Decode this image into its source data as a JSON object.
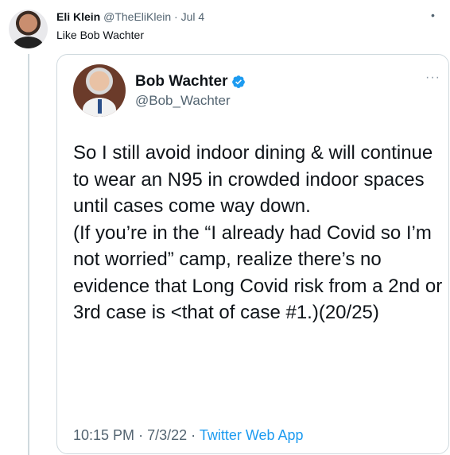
{
  "reply": {
    "author_name": "Eli Klein",
    "author_handle": "@TheEliKlein",
    "separator": "·",
    "date": "Jul 4",
    "more_icon": "more-horizontal-icon",
    "text": "Like Bob Wachter"
  },
  "quoted": {
    "author_name": "Bob Wachter",
    "author_handle": "@Bob_Wachter",
    "verified_color": "#1d9bf0",
    "more_label": "···",
    "body": "So I still avoid indoor dining & will continue to wear an N95 in crowded indoor spaces until cases come way down.\n(If you’re in the “I already had Covid so I’m not worried” camp, realize there’s no evidence that Long Covid risk from a 2nd or 3rd case is <that of case #1.)(20/25)",
    "time": "10:15 PM",
    "date": "7/3/22",
    "separator": "·",
    "source": "Twitter Web App"
  },
  "colors": {
    "text_primary": "#0f1419",
    "text_secondary": "#536471",
    "link": "#1d9bf0",
    "border": "#cfd9de"
  }
}
